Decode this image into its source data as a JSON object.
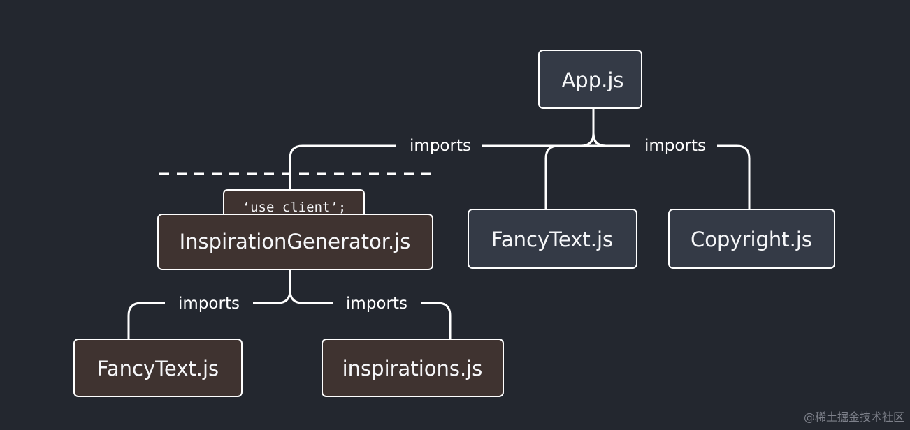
{
  "nodes": {
    "app": {
      "label": "App.js",
      "group": "server"
    },
    "inspiration_generator": {
      "label": "InspirationGenerator.js",
      "group": "client"
    },
    "fancy_text_server": {
      "label": "FancyText.js",
      "group": "server"
    },
    "copyright": {
      "label": "Copyright.js",
      "group": "server"
    },
    "fancy_text_client": {
      "label": "FancyText.js",
      "group": "client"
    },
    "inspirations": {
      "label": "inspirations.js",
      "group": "client"
    }
  },
  "edges": [
    {
      "from": "app",
      "to": "inspiration_generator",
      "label": "imports"
    },
    {
      "from": "app",
      "to": "fancy_text_server",
      "label": ""
    },
    {
      "from": "app",
      "to": "copyright",
      "label": "imports"
    },
    {
      "from": "inspiration_generator",
      "to": "fancy_text_client",
      "label": "imports"
    },
    {
      "from": "inspiration_generator",
      "to": "inspirations",
      "label": "imports"
    }
  ],
  "directive": {
    "text": "‘use client’;"
  },
  "colors": {
    "background": "#23272f",
    "server_node": "#343a46",
    "client_node": "#3f3330",
    "stroke": "#ffffff"
  },
  "watermark": "@稀土掘金技术社区"
}
